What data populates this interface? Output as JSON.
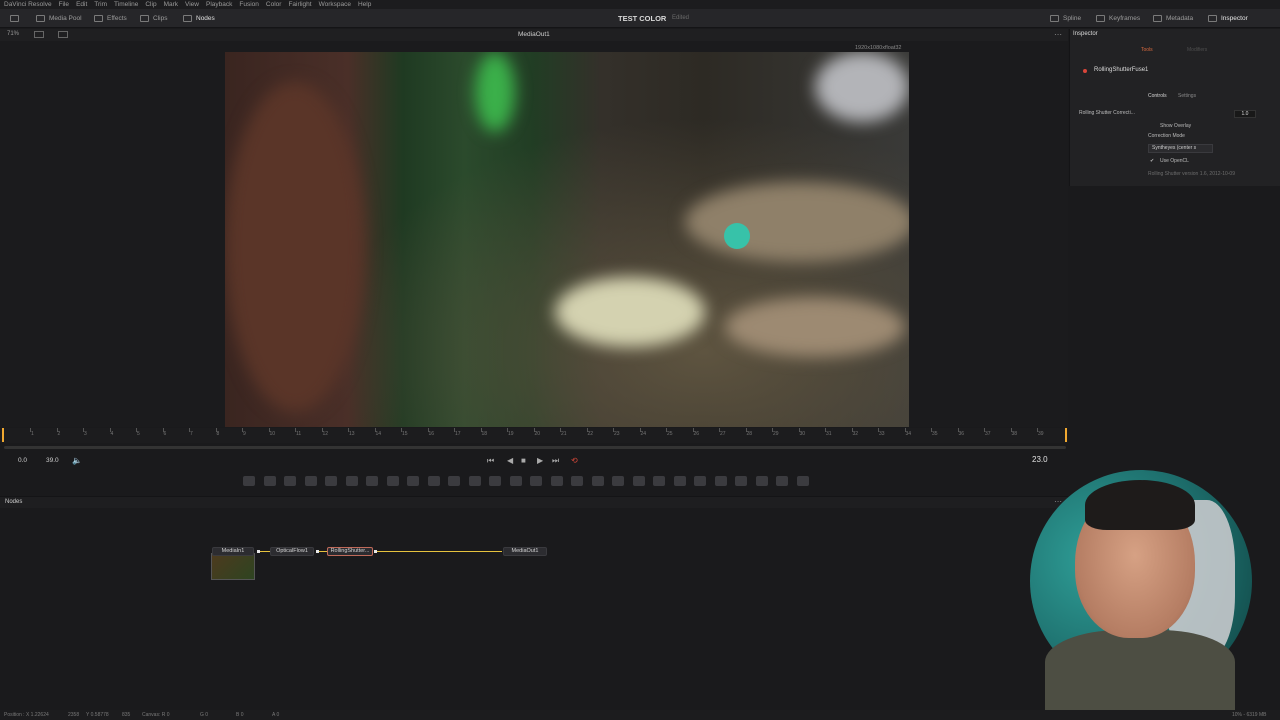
{
  "menubar": [
    "DaVinci Resolve",
    "File",
    "Edit",
    "Trim",
    "Timeline",
    "Clip",
    "Mark",
    "View",
    "Playback",
    "Fusion",
    "Color",
    "Fairlight",
    "Workspace",
    "Help"
  ],
  "toolbar": {
    "left": [
      {
        "label": "Media Pool",
        "icon": "media-pool-icon"
      },
      {
        "label": "Effects",
        "icon": "effects-icon"
      },
      {
        "label": "Clips",
        "icon": "clips-icon"
      },
      {
        "label": "Nodes",
        "icon": "nodes-icon"
      }
    ],
    "project_title": "TEST COLOR",
    "project_status": "Edited",
    "right": [
      {
        "label": "Spline",
        "icon": "spline-icon"
      },
      {
        "label": "Keyframes",
        "icon": "keyframes-icon"
      },
      {
        "label": "Metadata",
        "icon": "metadata-icon"
      },
      {
        "label": "Inspector",
        "icon": "inspector-icon"
      }
    ]
  },
  "viewer": {
    "zoom": "71%",
    "title": "MediaOut1",
    "resolution": "1920x1080xfloat32"
  },
  "ruler": [
    "1",
    "2",
    "3",
    "4",
    "5",
    "6",
    "7",
    "8",
    "9",
    "10",
    "11",
    "12",
    "13",
    "14",
    "15",
    "16",
    "17",
    "18",
    "19",
    "20",
    "21",
    "22",
    "23",
    "24",
    "25",
    "26",
    "27",
    "28",
    "29",
    "30",
    "31",
    "32",
    "33",
    "34",
    "35",
    "36",
    "37",
    "38",
    "39"
  ],
  "transport": {
    "start": "0.0",
    "end": "39.0",
    "current_frame": "23.0"
  },
  "nodes_panel": {
    "title": "Nodes",
    "nodes": [
      {
        "label": "MediaIn1"
      },
      {
        "label": "OpticalFlow1"
      },
      {
        "label": "RollingShutter..."
      },
      {
        "label": "MediaOut1"
      }
    ]
  },
  "inspector": {
    "title": "Inspector",
    "tabs": [
      "Tools",
      "Modifiers"
    ],
    "tool_name": "RollingShutterFuse1",
    "subtabs": [
      "Controls",
      "Settings"
    ],
    "control_label": "Rolling Shutter Correcti...",
    "control_value": "1.0",
    "show_overlay": "Show Overlay",
    "correction_mode_label": "Correction Mode",
    "correction_mode_value": "Syntheyes (center s",
    "use_opencl": "Use OpenCL",
    "version": "Rolling Shutter version 1.6, 2012-10-09"
  },
  "status_bar": {
    "position": "Position : X 1.22624",
    "y": "Y 0.58778",
    "px": "2358",
    "py": "835",
    "canvas": "Canvas: R 0",
    "g": "G 0",
    "b": "B 0",
    "a": "A 0",
    "memory": "10% - 6319 MB"
  }
}
